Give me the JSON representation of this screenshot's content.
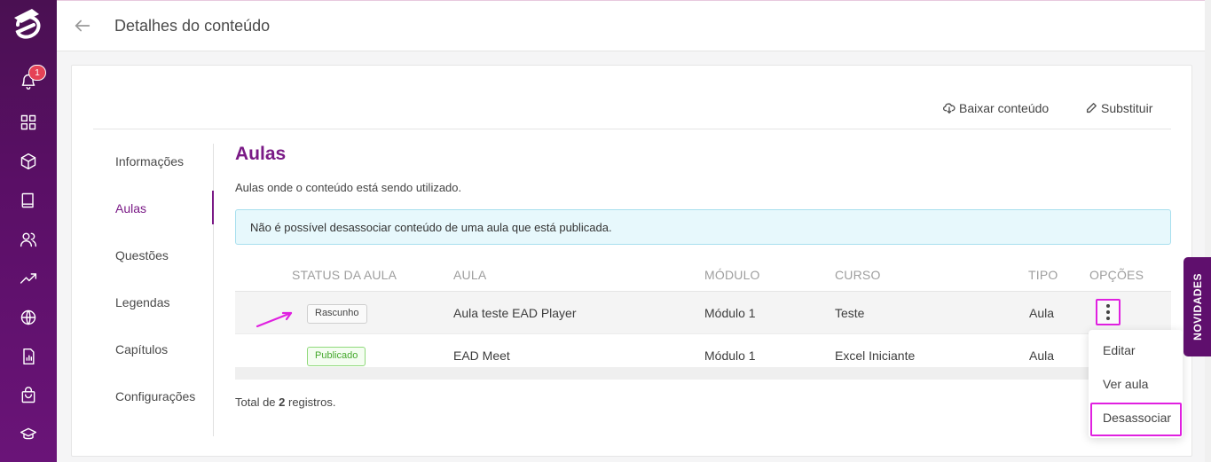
{
  "sidebar": {
    "notification_count": "1",
    "icons": [
      "bell-icon",
      "grid-icon",
      "cube-icon",
      "book-icon",
      "users-icon",
      "trending-icon",
      "globe-icon",
      "report-icon",
      "bag-icon",
      "graduation-cap-icon"
    ]
  },
  "header": {
    "title": "Detalhes do conteúdo"
  },
  "toolbar": {
    "download_label": "Baixar conteúdo",
    "replace_label": "Substituir"
  },
  "left_nav": {
    "items": [
      "Informações",
      "Aulas",
      "Questões",
      "Legendas",
      "Capítulos",
      "Configurações"
    ],
    "active": "Aulas"
  },
  "main": {
    "title": "Aulas",
    "description": "Aulas onde o conteúdo está sendo utilizado.",
    "alert": "Não é possível desassociar conteúdo de uma aula que está publicada."
  },
  "table": {
    "headers": [
      "STATUS DA AULA",
      "AULA",
      "MÓDULO",
      "CURSO",
      "TIPO",
      "OPÇÕES"
    ],
    "rows": [
      {
        "status": "Rascunho",
        "aula": "Aula teste EAD Player",
        "modulo": "Módulo 1",
        "curso": "Teste",
        "tipo": "Aula"
      },
      {
        "status": "Publicado",
        "aula": "EAD Meet",
        "modulo": "Módulo 1",
        "curso": "Excel Iniciante",
        "tipo": "Aula"
      }
    ],
    "total_prefix": "Total de ",
    "total_count": "2",
    "total_suffix": " registros."
  },
  "menu": {
    "items": [
      "Editar",
      "Ver aula",
      "Desassociar"
    ]
  },
  "novidades_label": "NOVIDADES",
  "colors": {
    "brand": "#7a1a86",
    "highlight": "#e020e0",
    "alert_bg": "#e7f8fc",
    "published": "#44a82c"
  }
}
